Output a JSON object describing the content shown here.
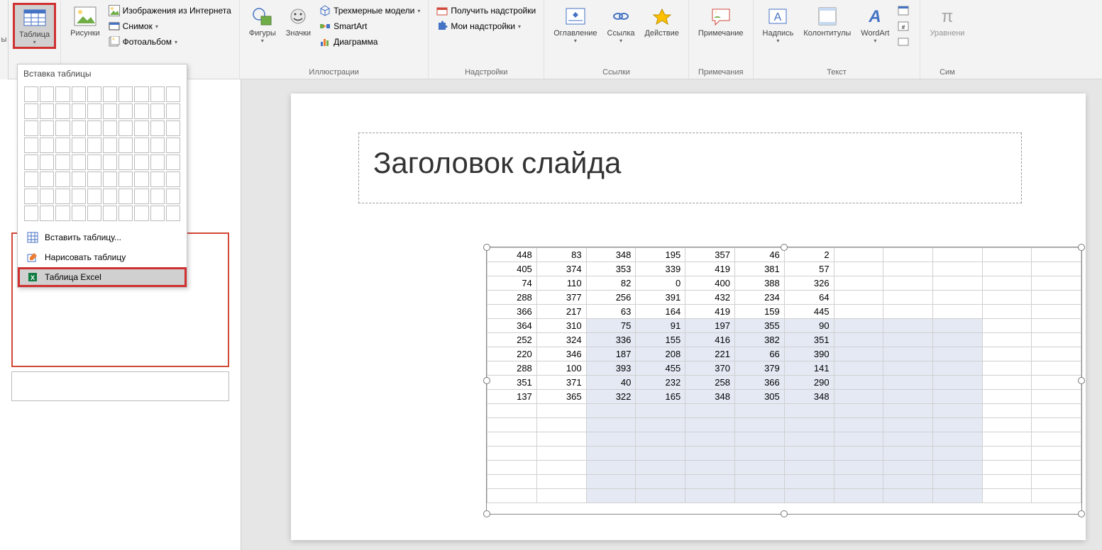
{
  "ribbon": {
    "table": "Таблица",
    "pictures": "Рисунки",
    "online_pictures": "Изображения из Интернета",
    "screenshot": "Снимок",
    "photo_album": "Фотоальбом",
    "shapes": "Фигуры",
    "icons": "Значки",
    "models3d": "Трехмерные модели",
    "smartart": "SmartArt",
    "chart": "Диаграмма",
    "get_addins": "Получить надстройки",
    "my_addins": "Мои надстройки",
    "toc": "Оглавление",
    "link": "Ссылка",
    "action": "Действие",
    "comment": "Примечание",
    "textbox": "Надпись",
    "header_footer": "Колонтитулы",
    "wordart": "WordArt",
    "equation": "Уравнени",
    "group_illustrations": "Иллюстрации",
    "group_addins": "Надстройки",
    "group_links": "Ссылки",
    "group_comments": "Примечания",
    "group_text": "Текст",
    "group_sym": "Сим"
  },
  "dropdown": {
    "header": "Вставка таблицы",
    "insert_table": "Вставить таблицу...",
    "draw_table": "Нарисовать таблицу",
    "excel_table": "Таблица Excel"
  },
  "slide": {
    "title": "Заголовок слайда"
  },
  "chart_data": {
    "type": "table",
    "title": "",
    "columns": 12,
    "rows": 18,
    "data_rows": [
      [
        448,
        83,
        348,
        195,
        357,
        46,
        2,
        null,
        null,
        null,
        null,
        null
      ],
      [
        405,
        374,
        353,
        339,
        419,
        381,
        57,
        null,
        null,
        null,
        null,
        null
      ],
      [
        74,
        110,
        82,
        0,
        400,
        388,
        326,
        null,
        null,
        null,
        null,
        null
      ],
      [
        288,
        377,
        256,
        391,
        432,
        234,
        64,
        null,
        null,
        null,
        null,
        null
      ],
      [
        366,
        217,
        63,
        164,
        419,
        159,
        445,
        null,
        null,
        null,
        null,
        null
      ],
      [
        364,
        310,
        75,
        91,
        197,
        355,
        90,
        null,
        null,
        null,
        null,
        null
      ],
      [
        252,
        324,
        336,
        155,
        416,
        382,
        351,
        null,
        null,
        null,
        null,
        null
      ],
      [
        220,
        346,
        187,
        208,
        221,
        66,
        390,
        null,
        null,
        null,
        null,
        null
      ],
      [
        288,
        100,
        393,
        455,
        370,
        379,
        141,
        null,
        null,
        null,
        null,
        null
      ],
      [
        351,
        371,
        40,
        232,
        258,
        366,
        290,
        null,
        null,
        null,
        null,
        null
      ],
      [
        137,
        365,
        322,
        165,
        348,
        305,
        348,
        null,
        null,
        null,
        null,
        null
      ],
      [
        null,
        null,
        null,
        null,
        null,
        null,
        null,
        null,
        null,
        null,
        null,
        null
      ],
      [
        null,
        null,
        null,
        null,
        null,
        null,
        null,
        null,
        null,
        null,
        null,
        null
      ],
      [
        null,
        null,
        null,
        null,
        null,
        null,
        null,
        null,
        null,
        null,
        null,
        null
      ],
      [
        null,
        null,
        null,
        null,
        null,
        null,
        null,
        null,
        null,
        null,
        null,
        null
      ],
      [
        null,
        null,
        null,
        null,
        null,
        null,
        null,
        null,
        null,
        null,
        null,
        null
      ],
      [
        null,
        null,
        null,
        null,
        null,
        null,
        null,
        null,
        null,
        null,
        null,
        null
      ],
      [
        null,
        null,
        null,
        null,
        null,
        null,
        null,
        null,
        null,
        null,
        null,
        null
      ]
    ],
    "shaded_region": {
      "row_start": 5,
      "col_start": 2,
      "col_end": 9
    }
  }
}
